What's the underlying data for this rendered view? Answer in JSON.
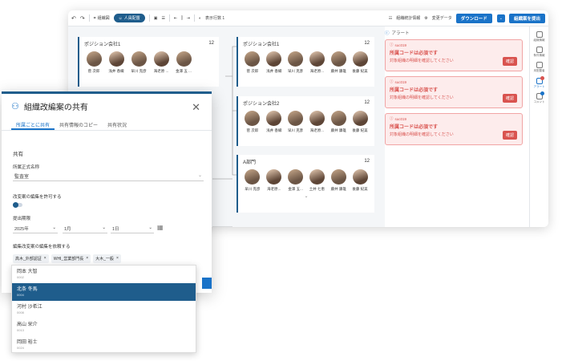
{
  "toolbar": {
    "undo": "↶",
    "redo": "↷",
    "org_chart": "組織図",
    "placement": "人員配置",
    "columns": "表示行数 1",
    "stats": "組織統計情報",
    "change_data": "変更データ",
    "download": "ダウンロード",
    "share": "組織案を提出"
  },
  "cards": [
    {
      "title": "ポジション会社1",
      "count": "12",
      "people": [
        "菅 次郎",
        "浅井 香織",
        "早川 克彦",
        "海老原 ...",
        "金澤 五 ..."
      ]
    },
    {
      "title": "ポジション会社1",
      "count": "12",
      "people": [
        "菅 次郎",
        "浅井 香織",
        "早川 克彦",
        "海老原...",
        "藤井 康雄",
        "後藤 紀美"
      ]
    },
    {
      "title": "ポジション会社2",
      "count": "12",
      "people": [
        "菅 次郎",
        "浅井 香織",
        "早川 克彦",
        "海老原...",
        "藤井 康雄",
        "後藤 紀美"
      ]
    },
    {
      "title": "A部門",
      "count": "12",
      "people": [
        "早川 克彦",
        "海老原...",
        "金澤 五...",
        "土井 七恵",
        "藤井 康雄",
        "後藤 紀美"
      ]
    }
  ],
  "alerts": {
    "title": "アラート",
    "items": [
      {
        "code": "suc019",
        "msg": "所属コードは必須です",
        "sub": "対象組織の明細を確認してください",
        "btn": "確認"
      },
      {
        "code": "suc019",
        "msg": "所属コードは必須です",
        "sub": "対象組織の明細を確認してください",
        "btn": "確認"
      },
      {
        "code": "suc019",
        "msg": "所属コードは必須です",
        "sub": "対象組織の明細を確認してください",
        "btn": "確認"
      }
    ]
  },
  "sidebar": {
    "items": [
      "組織情報",
      "条件情報",
      "未配置者",
      "アラート",
      "コメント"
    ]
  },
  "modal": {
    "title": "組織改編案の共有",
    "tabs": [
      "所属ごとに共有",
      "共有情報のコピー",
      "共有状況"
    ],
    "section": "共有",
    "dept_label": "所属正式名称",
    "dept_value": "監査室",
    "edit_label": "改変案の編集を許可する",
    "deadline_label": "提出期限",
    "year": "2025年",
    "month": "1月",
    "day": "1日",
    "requester_label": "編集改変案の編集を依頼する",
    "chips": [
      "高木_外部認証",
      "WHI_営業部門長",
      "大木_一般"
    ],
    "chip_x": "×",
    "dropdown": [
      {
        "name": "岡本 大智",
        "code": "0002"
      },
      {
        "name": "北条 冬馬",
        "code": "0004"
      },
      {
        "name": "河村 沙希江",
        "code": "0008"
      },
      {
        "name": "高山 栄介",
        "code": "0013"
      },
      {
        "name": "岡田 裕士",
        "code": "0024"
      }
    ]
  },
  "colors": {
    "primary": "#1f5d8c",
    "accent": "#1a73c8",
    "error": "#d9534f"
  }
}
